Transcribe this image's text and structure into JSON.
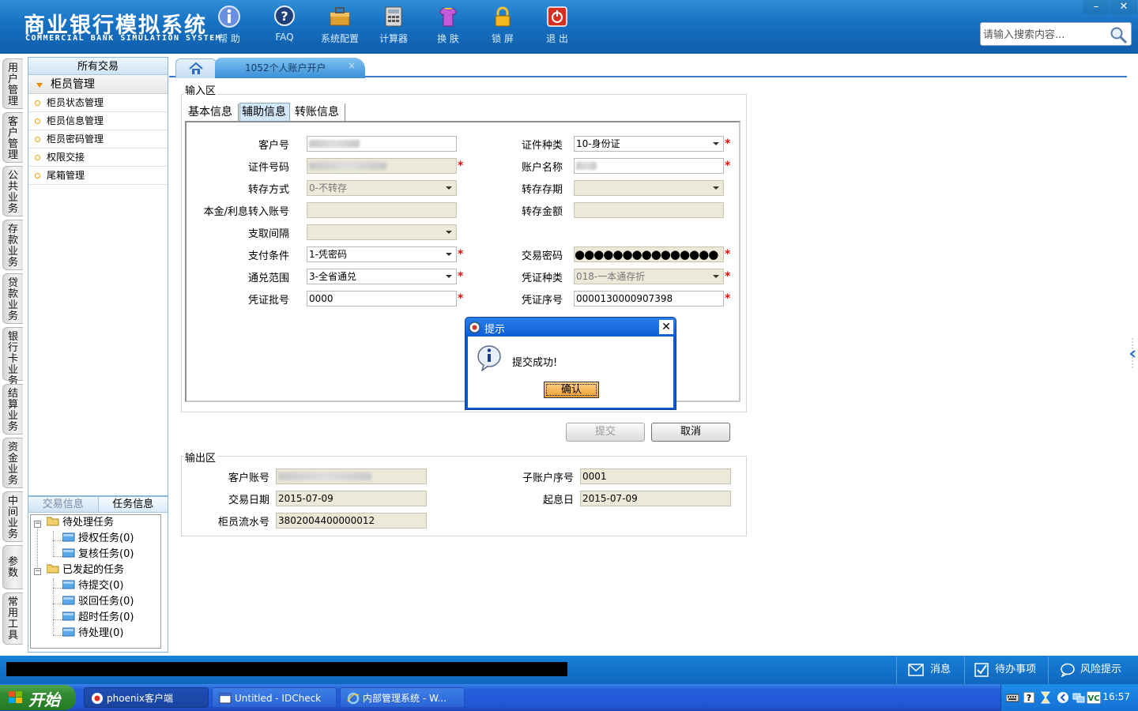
{
  "app": {
    "title_cn": "商业银行模拟系统",
    "title_en": "COMMERCIAL BANK SIMULATION SYSTEM"
  },
  "toolbar": [
    {
      "label": "帮 助",
      "icon": "help-icon"
    },
    {
      "label": "FAQ",
      "icon": "faq-icon"
    },
    {
      "label": "系统配置",
      "icon": "toolbox-icon"
    },
    {
      "label": "计算器",
      "icon": "calculator-icon"
    },
    {
      "label": "换 肤",
      "icon": "tshirt-icon"
    },
    {
      "label": "锁 屏",
      "icon": "lock-icon"
    },
    {
      "label": "退 出",
      "icon": "power-icon"
    }
  ],
  "window_controls": {
    "minimize": "–",
    "close": "✕"
  },
  "search": {
    "placeholder": "请输入搜索内容..."
  },
  "rail": [
    "用户管理",
    "客户管理",
    "公共业务",
    "存款业务",
    "贷款业务",
    "银行卡业务",
    "结算业务",
    "资金业务",
    "中间业务",
    "参数",
    "常用工具"
  ],
  "side_menu": {
    "header": "所有交易",
    "group": "柜员管理",
    "items": [
      "柜员状态管理",
      "柜员信息管理",
      "柜员密码管理",
      "权限交接",
      "尾箱管理"
    ]
  },
  "task_panel": {
    "tabs": [
      "交易信息",
      "任务信息"
    ],
    "tree": {
      "pending": "待处理任务",
      "authorize": "授权任务(0)",
      "review": "复核任务(0)",
      "initiated": "已发起的任务",
      "to_submit": "待提交(0)",
      "rejected": "驳回任务(0)",
      "timeout": "超时任务(0)",
      "to_process": "待处理(0)"
    }
  },
  "tabs": {
    "active_tab": "1052个人账户开户",
    "close": "×"
  },
  "input_area": {
    "legend": "输入区",
    "subtabs": [
      "基本信息",
      "辅助信息",
      "转账信息"
    ],
    "fields": {
      "customer_no_label": "客户号",
      "id_type_label": "证件种类",
      "id_type_value": "10-身份证",
      "id_no_label": "证件号码",
      "account_name_label": "账户名称",
      "transfer_mode_label": "转存方式",
      "transfer_mode_value": "0-不转存",
      "transfer_term_label": "转存存期",
      "principal_account_label": "本金/利息转入账号",
      "transfer_amount_label": "转存金额",
      "withdraw_interval_label": "支取间隔",
      "payment_cond_label": "支付条件",
      "payment_cond_value": "1-凭密码",
      "trade_pwd_label": "交易密码",
      "trade_pwd_value": "●●●●●●●●●●●●●●●",
      "exchange_range_label": "通兑范围",
      "exchange_range_value": "3-全省通兑",
      "voucher_type_label": "凭证种类",
      "voucher_type_value": "018-一本通存折",
      "voucher_batch_label": "凭证批号",
      "voucher_batch_value": "0000",
      "voucher_seq_label": "凭证序号",
      "voucher_seq_value": "0000130000907398"
    },
    "required_mark": "*",
    "submit": "提交",
    "cancel": "取消"
  },
  "output_area": {
    "legend": "输出区",
    "customer_account_label": "客户账号",
    "sub_account_label": "子账户序号",
    "sub_account_value": "0001",
    "trade_date_label": "交易日期",
    "trade_date_value": "2015-07-09",
    "value_date_label": "起息日",
    "value_date_value": "2015-07-09",
    "teller_serial_label": "柜员流水号",
    "teller_serial_value": "3802004400000012"
  },
  "dialog": {
    "title": "提示",
    "message": "提交成功!",
    "ok": "确认",
    "close": "✕"
  },
  "statusbar": {
    "messages": "消息",
    "todo": "待办事项",
    "risk": "风险提示"
  },
  "taskbar": {
    "start": "开始",
    "items": [
      "phoenix客户端",
      "Untitled - IDCheck",
      "内部管理系统 - W..."
    ],
    "clock": "16:57"
  },
  "colors": {
    "header_blue": "#1670c2",
    "required_red": "#e01010",
    "readonly_bg": "#ece9d8",
    "dialog_blue": "#0a5bd2"
  }
}
